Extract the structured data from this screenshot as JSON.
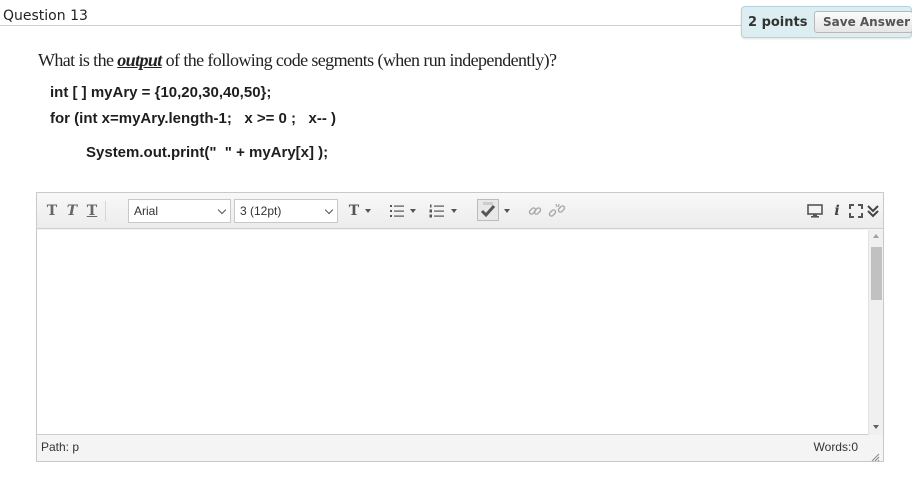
{
  "question": {
    "title": "Question 13",
    "points": "2 points",
    "save_label": "Save Answer"
  },
  "prompt": {
    "before": "What is the ",
    "emphasis": "output",
    "after": " of the following code segments (when run independently)?"
  },
  "code": {
    "line1": "int [ ] myAry = {10,20,30,40,50};",
    "line2": "for (int x=myAry.length-1;   x >= 0 ;   x-- )",
    "line3": "System.out.print(\"  \" + myAry[x] );"
  },
  "editor": {
    "font_family_value": "Arial",
    "font_size_value": "3 (12pt)",
    "content": "",
    "path_label": "Path: p",
    "word_count_label": "Words:0",
    "icons": [
      "text-bold-icon",
      "text-italic-icon",
      "text-underline-icon",
      "text-color-icon",
      "bullet-list-icon",
      "numbered-list-icon",
      "spellcheck-icon",
      "insert-link-icon",
      "remove-link-icon",
      "preview-icon",
      "info-icon",
      "fullscreen-icon",
      "collapse-toolbar-icon"
    ]
  },
  "colors": {
    "points_box_bg": "#ddeef3",
    "header_border": "#cfcfcf"
  }
}
